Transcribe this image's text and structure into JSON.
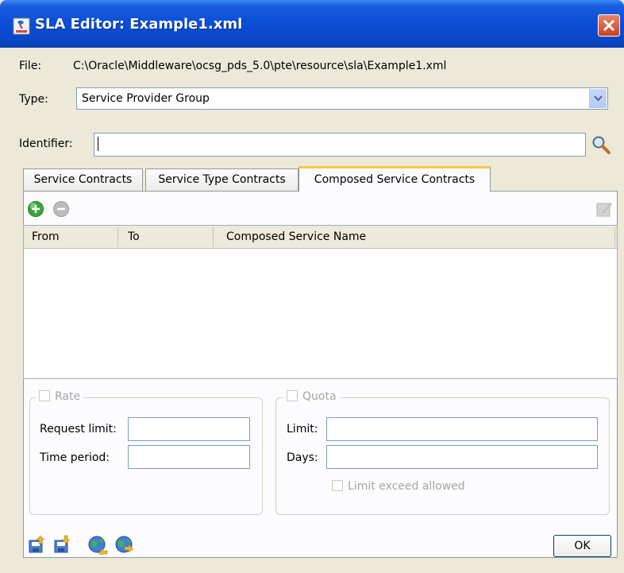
{
  "window": {
    "title": "SLA Editor: Example1.xml"
  },
  "file": {
    "label": "File:",
    "path": "C:\\Oracle\\Middleware\\ocsg_pds_5.0\\pte\\resource\\sla\\Example1.xml"
  },
  "type": {
    "label": "Type:",
    "selected": "Service Provider Group"
  },
  "identifier": {
    "label": "Identifier:",
    "value": ""
  },
  "tabs": [
    {
      "label": "Service Contracts",
      "active": false
    },
    {
      "label": "Service Type Contracts",
      "active": false
    },
    {
      "label": "Composed Service Contracts",
      "active": true
    }
  ],
  "table": {
    "columns": [
      "From",
      "To",
      "Composed Service Name"
    ],
    "rows": []
  },
  "rate": {
    "legend": "Rate",
    "request_limit_label": "Request limit:",
    "request_limit_value": "",
    "time_period_label": "Time period:",
    "time_period_value": ""
  },
  "quota": {
    "legend": "Quota",
    "limit_label": "Limit:",
    "limit_value": "",
    "days_label": "Days:",
    "days_value": "",
    "exceed_label": "Limit exceed allowed"
  },
  "footer": {
    "ok_label": "OK"
  },
  "colors": {
    "titlebar": "#0a48c8",
    "tab_highlight": "#ffc73c",
    "add_icon": "#3aa63a",
    "dialog_bg": "#ece9d8"
  },
  "icons": [
    "app-icon",
    "close-icon",
    "dropdown-arrow-icon",
    "search-icon",
    "add-icon",
    "remove-icon",
    "edit-icon",
    "export-icon",
    "import-icon",
    "globe-export-icon",
    "globe-import-icon"
  ]
}
